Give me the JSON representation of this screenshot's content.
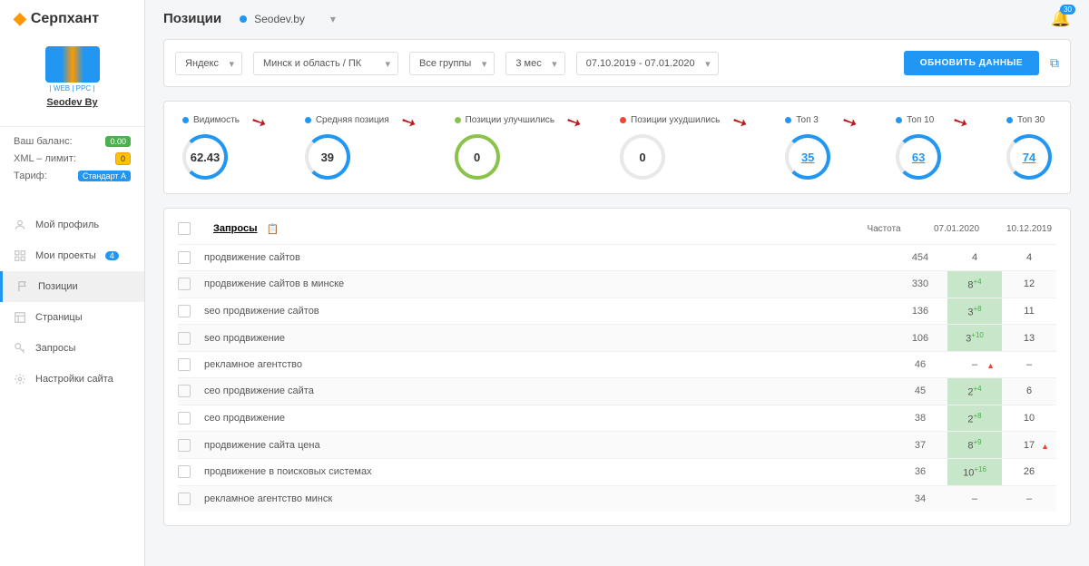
{
  "brand": "Серпхант",
  "profile": {
    "caption": "| WEB | PPC |",
    "name": "Seodev By"
  },
  "balance": {
    "label1": "Ваш баланс:",
    "val1": "0.00",
    "label2": "XML – лимит:",
    "val2": "0",
    "label3": "Тариф:",
    "val3": "Стандарт А"
  },
  "nav": {
    "profile": "Мой профиль",
    "projects": "Мои проекты",
    "projects_count": "4",
    "positions": "Позиции",
    "pages": "Страницы",
    "queries": "Запросы",
    "settings": "Настройки сайта"
  },
  "header": {
    "title": "Позиции",
    "project": "Seodev.by",
    "notifications": "30"
  },
  "filters": {
    "engine": "Яндекс",
    "region": "Минск и область / ПК",
    "group": "Все группы",
    "period": "3 мес",
    "dates": "07.10.2019 - 07.01.2020",
    "update": "ОБНОВИТЬ ДАННЫЕ"
  },
  "metrics": [
    {
      "label": "Видимость",
      "value": "62.43",
      "color": "#2196f3",
      "ring": "blue"
    },
    {
      "label": "Средняя позиция",
      "value": "39",
      "color": "#2196f3",
      "ring": "blue"
    },
    {
      "label": "Позиции улучшились",
      "value": "0",
      "color": "#8bc34a",
      "ring": "green"
    },
    {
      "label": "Позиции ухудшились",
      "value": "0",
      "color": "#f44336",
      "ring": "red"
    },
    {
      "label": "Топ 3",
      "value": "35",
      "color": "#2196f3",
      "ring": "blue",
      "link": true
    },
    {
      "label": "Топ 10",
      "value": "63",
      "color": "#2196f3",
      "ring": "blue",
      "link": true
    },
    {
      "label": "Топ 30",
      "value": "74",
      "color": "#2196f3",
      "ring": "blue",
      "link": true
    }
  ],
  "table": {
    "header_queries": "Запросы",
    "cols": [
      "Частота",
      "07.01.2020",
      "10.12.2019"
    ],
    "rows": [
      {
        "q": "продвижение сайтов",
        "freq": "454",
        "p1": "4",
        "d1": "",
        "p2": "4",
        "g": false
      },
      {
        "q": "продвижение сайтов в минске",
        "freq": "330",
        "p1": "8",
        "d1": "+4",
        "p2": "12",
        "g": true
      },
      {
        "q": "seo продвижение сайтов",
        "freq": "136",
        "p1": "3",
        "d1": "+8",
        "p2": "11",
        "g": true
      },
      {
        "q": "seo продвижение",
        "freq": "106",
        "p1": "3",
        "d1": "+10",
        "p2": "13",
        "g": true
      },
      {
        "q": "рекламное агентство",
        "freq": "46",
        "p1": "–",
        "d1": "",
        "p2": "–",
        "g": false,
        "w1": true
      },
      {
        "q": "сео продвижение сайта",
        "freq": "45",
        "p1": "2",
        "d1": "+4",
        "p2": "6",
        "g": true
      },
      {
        "q": "сео продвижение",
        "freq": "38",
        "p1": "2",
        "d1": "+8",
        "p2": "10",
        "g": true
      },
      {
        "q": "продвижение сайта цена",
        "freq": "37",
        "p1": "8",
        "d1": "+9",
        "p2": "17",
        "g": true,
        "w2": true
      },
      {
        "q": "продвижение в поисковых системах",
        "freq": "36",
        "p1": "10",
        "d1": "+16",
        "p2": "26",
        "g": true
      },
      {
        "q": "рекламное агентство минск",
        "freq": "34",
        "p1": "–",
        "d1": "",
        "p2": "–",
        "g": false
      }
    ]
  }
}
